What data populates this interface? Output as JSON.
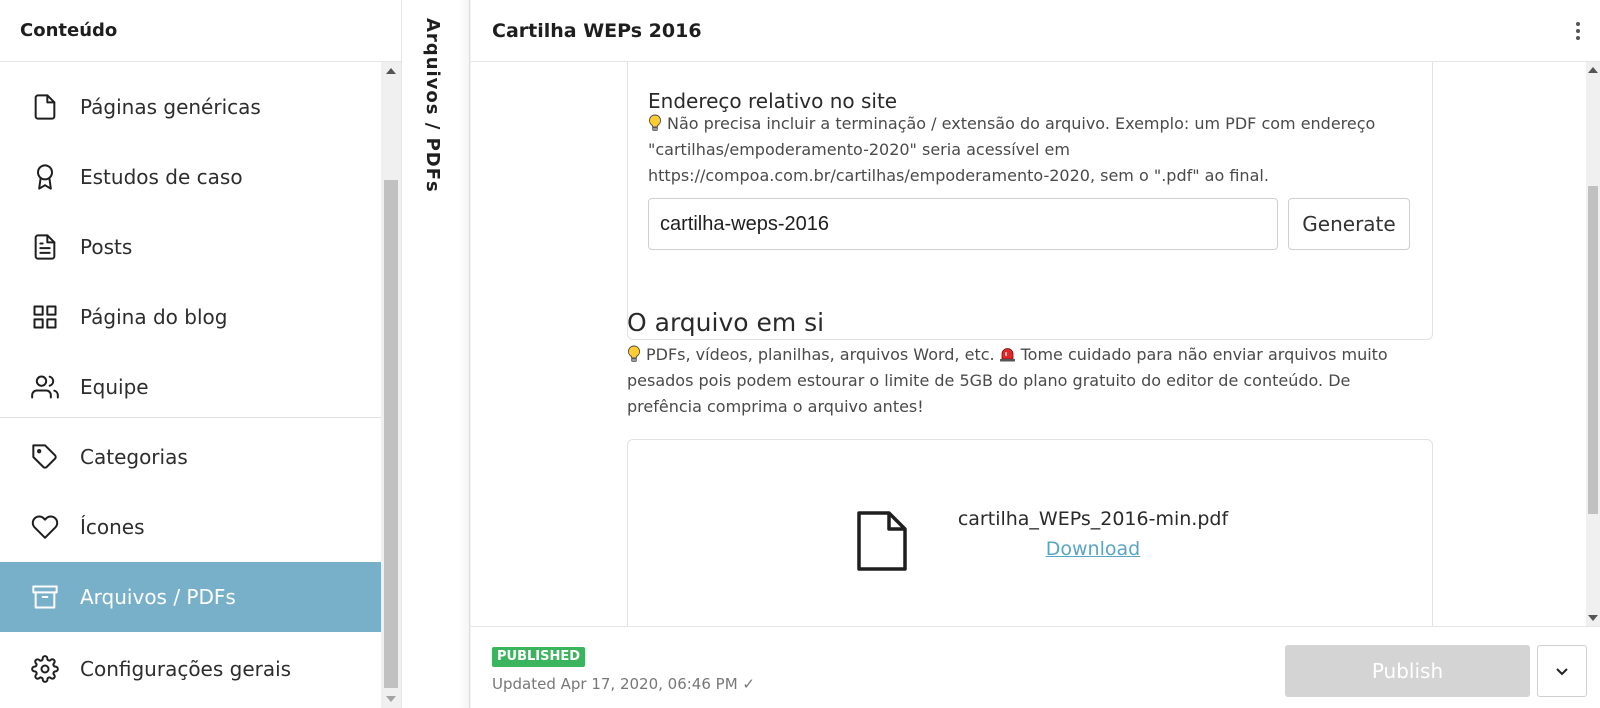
{
  "sidebar": {
    "title": "Conteúdo",
    "items": [
      {
        "label": "Páginas genéricas",
        "icon": "file-icon"
      },
      {
        "label": "Estudos de caso",
        "icon": "award-icon"
      },
      {
        "label": "Posts",
        "icon": "file-text-icon"
      },
      {
        "label": "Página do blog",
        "icon": "grid-icon"
      },
      {
        "label": "Equipe",
        "icon": "users-icon"
      },
      {
        "label": "Categorias",
        "icon": "tag-icon"
      },
      {
        "label": "Ícones",
        "icon": "heart-icon"
      },
      {
        "label": "Arquivos / PDFs",
        "icon": "archive-icon",
        "active": true
      },
      {
        "label": "Configurações gerais",
        "icon": "settings-icon"
      }
    ],
    "active_color": "#79b0c9"
  },
  "collapsed_pane": {
    "title": "Arquivos / PDFs"
  },
  "editor": {
    "title": "Cartilha WEPs 2016",
    "slug_field": {
      "label": "Endereço relativo no site",
      "hint": "Não precisa incluir a terminação / extensão do arquivo. Exemplo: um PDF com endereço \"cartilhas/empoderamento-2020\" seria acessível em https://compoa.com.br/cartilhas/empoderamento-2020, sem o \".pdf\" ao final.",
      "value": "cartilha-weps-2016",
      "generate_label": "Generate"
    },
    "file_field": {
      "title": "O arquivo em si",
      "hint_part1": "PDFs, vídeos, planilhas, arquivos Word, etc.",
      "hint_part2": "Tome cuidado para não enviar arquivos muito pesados pois podem estourar o limite de 5GB do plano gratuito do editor de conteúdo. De prefência comprima o arquivo antes!",
      "file_name": "cartilha_WEPs_2016-min.pdf",
      "download_label": "Download"
    },
    "footer": {
      "status": "PUBLISHED",
      "status_color": "#3bb55d",
      "updated": "Updated Apr 17, 2020, 06:46 PM ✓",
      "publish_label": "Publish"
    }
  }
}
